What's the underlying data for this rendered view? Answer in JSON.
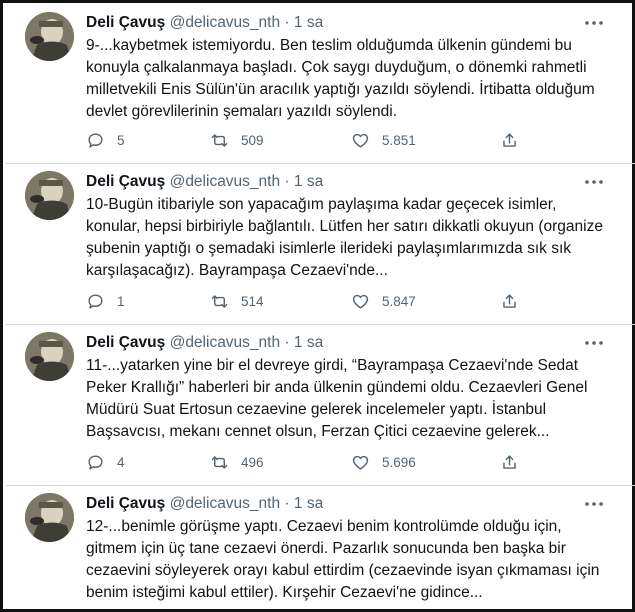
{
  "tweets": [
    {
      "name": "Deli Çavuş",
      "handle": "@delicavus_nth",
      "dot": "·",
      "time": "1 sa",
      "lines": [
        "9-...kaybetmek istemiyordu. Ben teslim olduğumda ülkenin gündemi bu",
        "konuyla çalkalanmaya başladı. Çok saygı duyduğum, o dönemki rahmetli",
        "milletvekili Enis Sülün'ün aracılık yaptığı yazıldı söylendi. İrtibatta olduğum",
        "devlet görevlilerinin şemaları yazıldı söylendi."
      ],
      "replies": "5",
      "retweets": "509",
      "likes": "5.851"
    },
    {
      "name": "Deli Çavuş",
      "handle": "@delicavus_nth",
      "dot": "·",
      "time": "1 sa",
      "lines": [
        "10-Bugün itibariyle son yapacağım paylaşıma kadar geçecek isimler,",
        "konular, hepsi birbiriyle bağlantılı. Lütfen her satırı dikkatli okuyun (organize",
        "şubenin yaptığı o şemadaki isimlerle ilerideki paylaşımlarımızda sık sık",
        "karşılaşacağız). Bayrampaşa Cezaevi'nde..."
      ],
      "replies": "1",
      "retweets": "514",
      "likes": "5.847"
    },
    {
      "name": "Deli Çavuş",
      "handle": "@delicavus_nth",
      "dot": "·",
      "time": "1 sa",
      "lines": [
        "11-...yatarken yine bir el devreye girdi, “Bayrampaşa Cezaevi'nde Sedat",
        "Peker Krallığı” haberleri bir anda ülkenin gündemi oldu. Cezaevleri Genel",
        "Müdürü Suat Ertosun cezaevine gelerek incelemeler yaptı. İstanbul",
        "Başsavcısı, mekanı cennet olsun, Ferzan Çitici cezaevine gelerek..."
      ],
      "replies": "4",
      "retweets": "496",
      "likes": "5.696"
    },
    {
      "name": "Deli Çavuş",
      "handle": "@delicavus_nth",
      "dot": "·",
      "time": "1 sa",
      "lines": [
        "12-...benimle görüşme yaptı. Cezaevi benim kontrolümde olduğu için,",
        "gitmem için üç tane cezaevi önerdi. Pazarlık sonucunda ben başka bir",
        "cezaevini söyleyerek orayı kabul ettirdim (cezaevinde isyan çıkmaması için",
        "benim isteğimi kabul ettiler). Kırşehir Cezaevi'ne gidince..."
      ]
    }
  ],
  "icons": {
    "reply": "reply-icon",
    "retweet": "retweet-icon",
    "like": "heart-icon",
    "share": "share-icon",
    "more": "more-icon"
  },
  "colors": {
    "text": "#0f1419",
    "secondary": "#536471",
    "divider": "#cfd9de"
  }
}
